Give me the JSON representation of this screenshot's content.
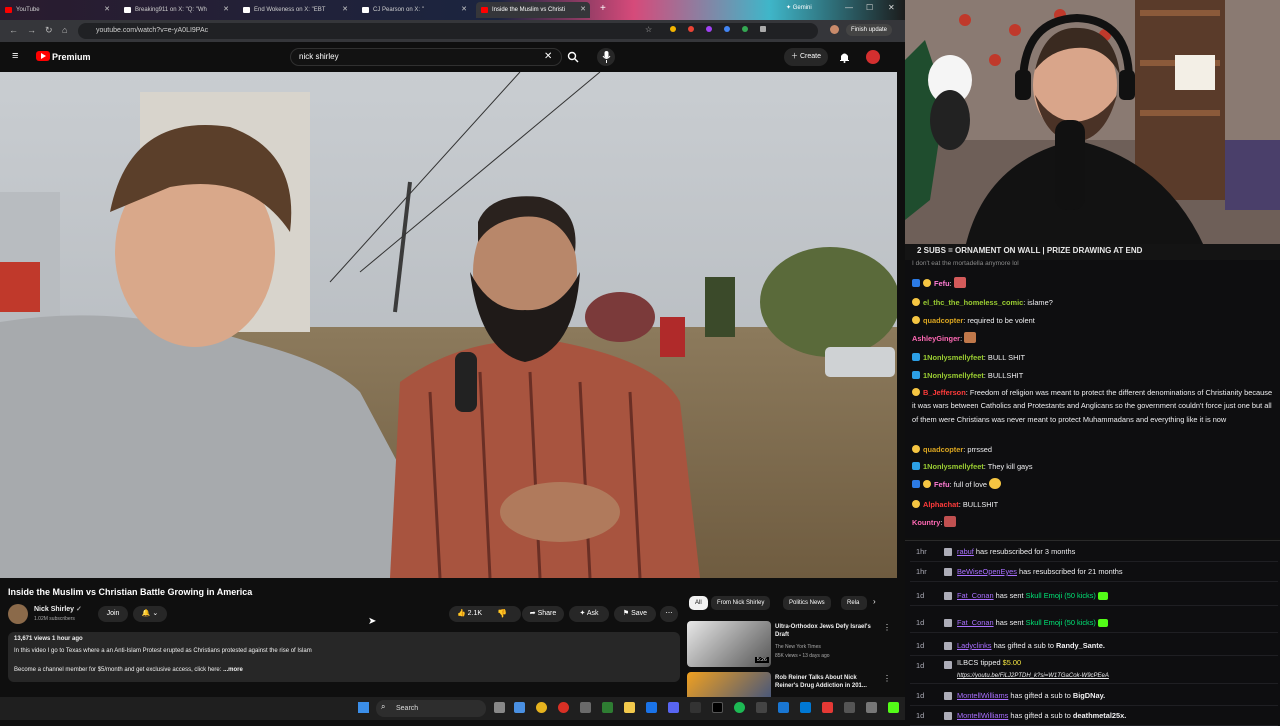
{
  "browser": {
    "tabs": [
      {
        "title": "YouTube",
        "color": "#ff0000"
      },
      {
        "title": "Breaking911 on X: \"Q: \"Wh",
        "color": "#ffffff"
      },
      {
        "title": "End Wokeness on X: \"EBT",
        "color": "#ffffff"
      },
      {
        "title": "CJ Pearson on X: \"",
        "color": "#ffffff"
      },
      {
        "title": "Inside the Muslim vs Christi",
        "color": "#ff0000",
        "active": true
      }
    ],
    "gemini_label": "Gemini",
    "url": "youtube.com/watch?v=e-yA0LI9PAc",
    "finish_update": "Finish update"
  },
  "youtube": {
    "brand": "Premium",
    "search_value": "nick shirley",
    "create_label": "Create",
    "video_title": "Inside the Muslim vs Christian Battle Growing in America",
    "channel_name": "Nick Shirley",
    "subscribers": "1.02M subscribers",
    "join_label": "Join",
    "likes": "2.1K",
    "share_label": "Share",
    "ask_label": "Ask",
    "save_label": "Save",
    "description": {
      "stats": "13,671 views  1 hour ago",
      "line1": "In this video I go to Texas where a an Anti-Islam Protest erupted as Christians protested against the rise of Islam",
      "line2": "Become a channel member for $5/month and get exclusive access, click here:",
      "more": "...more"
    },
    "chips": [
      "All",
      "From Nick Shirley",
      "Politics News",
      "Rela"
    ],
    "recommendations": [
      {
        "title": "Ultra-Orthodox Jews Defy Israel's Draft",
        "channel": "The New York Times",
        "meta": "85K views • 13 days ago",
        "duration": "5:26"
      },
      {
        "title": "Rob Reiner Talks About Nick Reiner's Drug Addiction in 201...",
        "channel": "",
        "meta": "",
        "duration": ""
      }
    ]
  },
  "taskbar": {
    "search_label": "Search"
  },
  "stream": {
    "banner": "2 SUBS = ORNAMENT ON WALL | PRIZE DRAWING AT END",
    "partial_top": "I don't eat the mortadella anymore lol",
    "chat": [
      {
        "user": "Fefu",
        "color": "#ff7bd3",
        "text": ""
      },
      {
        "user": "el_thc_the_homeless_comic",
        "color": "#9acd32",
        "text": "islame?"
      },
      {
        "user": "quadcopter",
        "color": "#daa520",
        "text": "required to be volent"
      },
      {
        "user": "AshleyGinger",
        "color": "#ff69b4",
        "text": ""
      },
      {
        "user": "1Nonlysmellyfeet",
        "color": "#9acd32",
        "text": "BULL SHIT"
      },
      {
        "user": "1Nonlysmellyfeet",
        "color": "#9acd32",
        "text": "BULLSHIT"
      },
      {
        "user": "B_Jefferson",
        "color": "#ff3b3b",
        "text": "Freedom of religion was meant to protect the different denominations of Christianity because it was wars between Catholics and Protestants and Anglicans so the government couldn't force just one but all of them were Christians was never meant to protect Muhammadans and everything like it is now"
      },
      {
        "user": "quadcopter",
        "color": "#daa520",
        "text": "prrssed"
      },
      {
        "user": "1Nonlysmellyfeet",
        "color": "#9acd32",
        "text": "They kill gays"
      },
      {
        "user": "Fefu",
        "color": "#ff7bd3",
        "text": "full of love"
      },
      {
        "user": "Alphachat",
        "color": "#ff3b3b",
        "text": "BULLSHIT"
      },
      {
        "user": "Kountry",
        "color": "#ff69b4",
        "text": ""
      }
    ],
    "events": [
      {
        "time": "1hr",
        "user": "rabuf",
        "text": "has resubscribed for 3 months"
      },
      {
        "time": "1hr",
        "user": "BeWiseOpenEyes",
        "text": "has resubscribed for 21 months"
      },
      {
        "time": "1d",
        "user": "Fat_Conan",
        "text": "has sent",
        "highlight": "Skull Emoji (50 kicks)"
      },
      {
        "time": "1d",
        "user": "Fat_Conan",
        "text": "has sent",
        "highlight": "Skull Emoji (50 kicks)"
      },
      {
        "time": "1d",
        "user": "Ladyclinks",
        "text": "has gifted a sub to",
        "target": "Randy_Sante."
      },
      {
        "time": "1d",
        "user": "ILBCS",
        "text": "tipped",
        "amount": "$5.00",
        "link": "https://youtu.be/FiLJ2PTDH_k?si=W1TGaCok-W9cPEeA"
      },
      {
        "time": "1d",
        "user": "MontellWilliams",
        "text": "has gifted a sub to",
        "target": "BigDNay."
      },
      {
        "time": "1d",
        "user": "MontellWilliams",
        "text": "has gifted a sub to",
        "target": "deathmetal25x."
      }
    ]
  }
}
